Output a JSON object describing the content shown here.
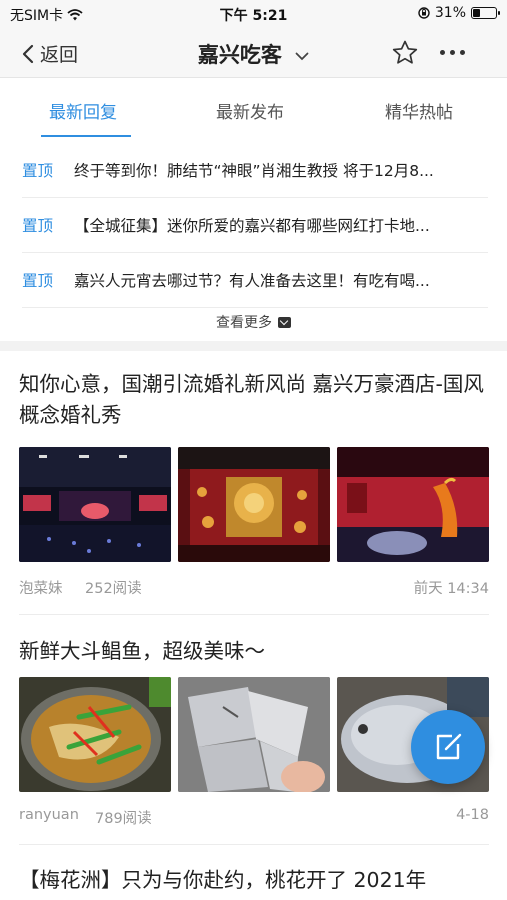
{
  "status_bar": {
    "carrier": "无SIM卡",
    "time": "下午 5:21",
    "battery": "31%",
    "battery_level": 0.31
  },
  "nav": {
    "back_label": "返回",
    "title": "嘉兴吃客"
  },
  "tabs": [
    {
      "label": "最新回复",
      "active": true
    },
    {
      "label": "最新发布",
      "active": false
    },
    {
      "label": "精华热帖",
      "active": false
    }
  ],
  "pinned": {
    "items": [
      {
        "tag": "置顶",
        "text": "终于等到你！肺结节“神眼”肖湘生教授 将于12月8..."
      },
      {
        "tag": "置顶",
        "text": "【全城征集】迷你所爱的嘉兴都有哪些网红打卡地..."
      },
      {
        "tag": "置顶",
        "text": "嘉兴人元宵去哪过节？有人准备去这里！有吃有喝..."
      }
    ],
    "see_more": "查看更多"
  },
  "posts": [
    {
      "title": "知你心意，国潮引流婚礼新风尚 嘉兴万豪酒店-国风概念婚礼秀",
      "author": "泡菜妹",
      "reads": "252阅读",
      "date": "前天 14:34"
    },
    {
      "title": "新鲜大斗鲳鱼，超级美味～",
      "author": "ranyuan",
      "reads": "789阅读",
      "date": "4-18"
    },
    {
      "title": "【梅花洲】只为与你赴约，桃花开了 2021年"
    }
  ],
  "colors": {
    "accent": "#2f8ee0",
    "meta_text": "#999999",
    "nav_bg": "#f7f7f7"
  },
  "icons": [
    "wifi-icon",
    "back-chevron-icon",
    "chevron-down-icon",
    "star-icon",
    "more-icon",
    "mail-icon",
    "compose-icon"
  ]
}
